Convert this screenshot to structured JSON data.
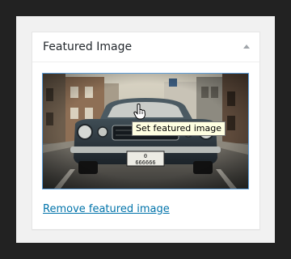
{
  "metabox": {
    "title": "Featured Image",
    "toggle_icon": "triangle-up-icon",
    "image_alt": "Vintage car parked on a city street",
    "plate_top": "0",
    "plate_bottom": "666666",
    "remove_link": "Remove featured image"
  },
  "tooltip": {
    "text": "Set featured image"
  },
  "cursor_icon": "hand-pointer-icon",
  "colors": {
    "outer_background": "#222222",
    "panel_background": "#f1f1f1",
    "box_background": "#ffffff",
    "link": "#0073aa",
    "focus_outline": "#5b9dd9",
    "tooltip_background": "#ffffe1"
  }
}
